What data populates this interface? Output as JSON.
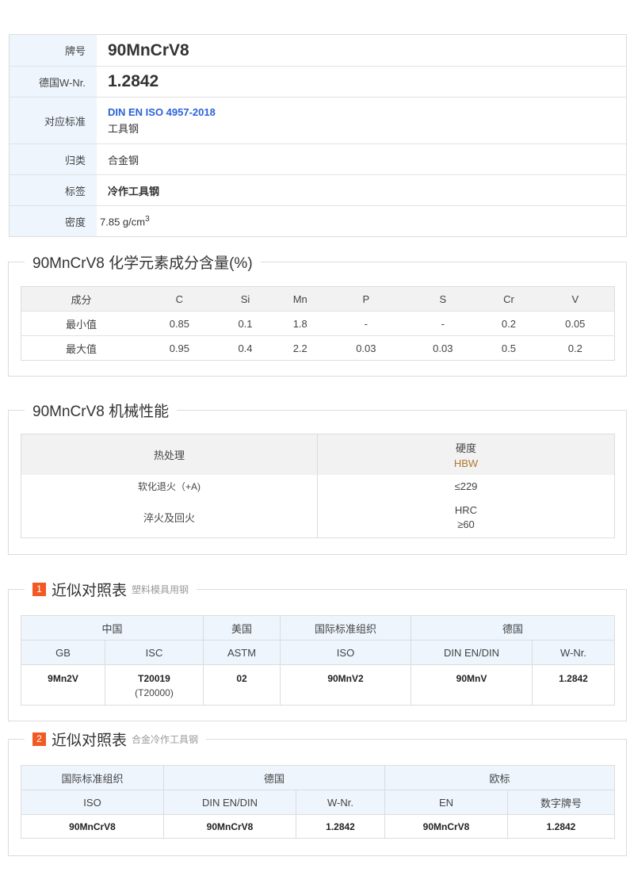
{
  "info": {
    "grade_label": "牌号",
    "grade_value": "90MnCrV8",
    "wnr_label": "德国W-Nr.",
    "wnr_value": "1.2842",
    "std_label": "对应标准",
    "std_link": "DIN EN ISO 4957-2018",
    "std_sub": "工具钢",
    "category_label": "归类",
    "category_value": "合金钢",
    "tag_label": "标签",
    "tag_value": "冷作工具钢",
    "density_label": "密度",
    "density_value": "7.85 g/cm",
    "density_sup": "3"
  },
  "chemistry": {
    "title": "90MnCrV8 化学元素成分含量(%)",
    "headers": [
      "成分",
      "C",
      "Si",
      "Mn",
      "P",
      "S",
      "Cr",
      "V"
    ],
    "min_row": [
      "最小值",
      "0.85",
      "0.1",
      "1.8",
      "-",
      "-",
      "0.2",
      "0.05"
    ],
    "max_row": [
      "最大值",
      "0.95",
      "0.4",
      "2.2",
      "0.03",
      "0.03",
      "0.5",
      "0.2"
    ]
  },
  "mechanical": {
    "title": "90MnCrV8 机械性能",
    "col1": "热处理",
    "col2": "硬度",
    "col2_unit": "HBW",
    "row1_label": "软化退火（+A)",
    "row1_value": "≤229",
    "row2_label": "淬火及回火",
    "row2_unit": "HRC",
    "row2_value": "≥60"
  },
  "compare1": {
    "num": "1",
    "title": "近似对照表",
    "subtitle": "塑料模具用钢",
    "groups": [
      "中国",
      "美国",
      "国际标准组织",
      "德国"
    ],
    "cols": [
      "GB",
      "ISC",
      "ASTM",
      "ISO",
      "DIN EN/DIN",
      "W-Nr."
    ],
    "vals": [
      "9Mn2V",
      "T20019",
      "02",
      "90MnV2",
      "90MnV",
      "1.2842"
    ],
    "isc_alt": "(T20000)"
  },
  "compare2": {
    "num": "2",
    "title": "近似对照表",
    "subtitle": "合金冷作工具钢",
    "groups": [
      "国际标准组织",
      "德国",
      "欧标"
    ],
    "cols": [
      "ISO",
      "DIN EN/DIN",
      "W-Nr.",
      "EN",
      "数字牌号"
    ],
    "vals": [
      "90MnCrV8",
      "90MnCrV8",
      "1.2842",
      "90MnCrV8",
      "1.2842"
    ]
  }
}
